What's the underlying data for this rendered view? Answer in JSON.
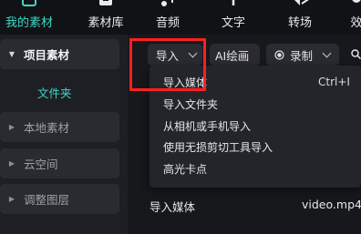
{
  "toolbar": {
    "tabs": [
      {
        "label": "我的素材",
        "icon": "my-media-icon",
        "active": true
      },
      {
        "label": "素材库",
        "icon": "media-library-icon",
        "active": false
      },
      {
        "label": "音频",
        "icon": "audio-icon",
        "active": false
      },
      {
        "label": "文字",
        "icon": "text-icon",
        "active": false
      },
      {
        "label": "转场",
        "icon": "transition-icon",
        "active": false
      },
      {
        "label": "效",
        "icon": "effects-icon",
        "active": false
      }
    ]
  },
  "sidebar": {
    "project_label": "项目素材",
    "folder_label": "文件夹",
    "items": [
      {
        "label": "本地素材"
      },
      {
        "label": "云空间"
      },
      {
        "label": "调整图层"
      }
    ]
  },
  "main": {
    "import_button": "导入",
    "ai_draw_button": "AI绘画",
    "record_button": "录制"
  },
  "import_menu": {
    "items": [
      {
        "label": "导入媒体",
        "shortcut": "Ctrl+I"
      },
      {
        "label": "导入文件夹",
        "shortcut": ""
      },
      {
        "label": "从相机或手机导入",
        "shortcut": ""
      },
      {
        "label": "使用无损剪切工具导入",
        "shortcut": ""
      },
      {
        "label": "高光卡点",
        "shortcut": ""
      }
    ]
  },
  "media": {
    "import_media_label": "导入媒体",
    "video_label": "video.mp4"
  },
  "colors": {
    "accent": "#3fd7c6",
    "highlight_box": "#ff1f1f",
    "panel_bg": "#1e1f24",
    "menu_bg": "#24252b"
  }
}
